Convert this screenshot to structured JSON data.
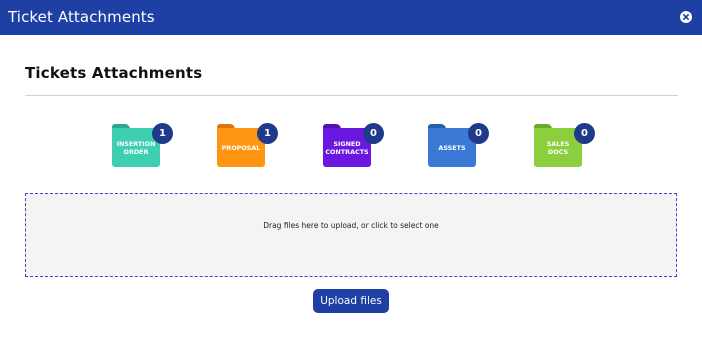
{
  "window": {
    "title": "Ticket Attachments",
    "close_icon": "close-circle-icon"
  },
  "section": {
    "title": "Tickets Attachments"
  },
  "folders": [
    {
      "label": "INSERTION\nORDER",
      "count": "1",
      "icon": "folder-icon",
      "color": "#3ecfb0",
      "tab_color": "#2aa88e"
    },
    {
      "label": "PROPOSAL",
      "count": "1",
      "icon": "folder-icon",
      "color": "#ff9612",
      "tab_color": "#d9790a"
    },
    {
      "label": "SIGNED\nCONTRACTS",
      "count": "0",
      "icon": "folder-icon",
      "color": "#6a18e0",
      "tab_color": "#5210b8"
    },
    {
      "label": "ASSETS",
      "count": "0",
      "icon": "folder-icon",
      "color": "#3a7ad6",
      "tab_color": "#2a5eb0"
    },
    {
      "label": "SALES\nDOCS",
      "count": "0",
      "icon": "folder-icon",
      "color": "#8ccf3e",
      "tab_color": "#6aa828"
    }
  ],
  "dropzone": {
    "hint": "Drag files here to upload, or click to select one"
  },
  "upload_button": {
    "label": "Upload files"
  },
  "colors": {
    "header": "#1e3fa3",
    "badge": "#1f3a8a",
    "dropzone_border": "#4b3fc7",
    "dropzone_bg": "#f4f4f4"
  }
}
